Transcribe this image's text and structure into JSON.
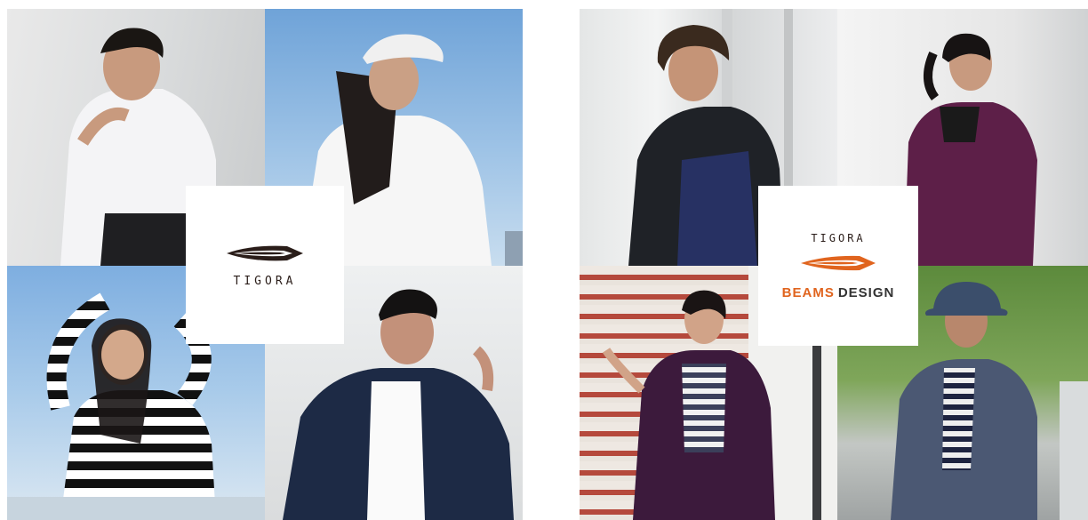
{
  "left_panel": {
    "brand": "TIGORA",
    "brand_color": "#2a1d19"
  },
  "right_panel": {
    "brand": "TIGORA",
    "collab_part1": "BEAMS",
    "collab_part2": "DESIGN",
    "brand_color": "#e0641e"
  }
}
